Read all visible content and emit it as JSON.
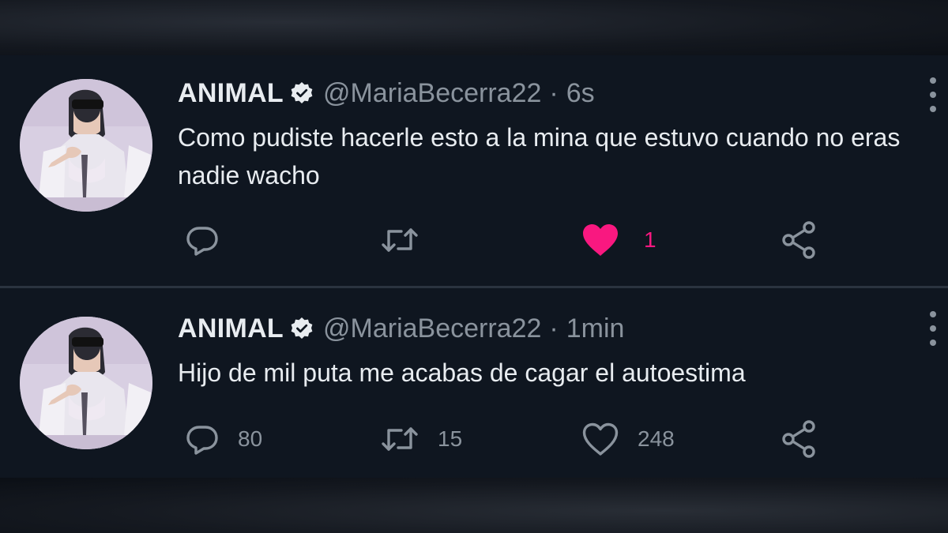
{
  "tweets": [
    {
      "name": "ANIMAL",
      "handle": "@MariaBecerra22",
      "separator": "·",
      "time": "6s",
      "text": "Como pudiste hacerle esto a la mina que estuvo cuando no eras nadie wacho",
      "replies": "",
      "retweets": "",
      "likes": "1",
      "liked": true,
      "icons": [
        "reply-icon",
        "retweet-icon",
        "heart-filled-icon",
        "share-icon"
      ]
    },
    {
      "name": "ANIMAL",
      "handle": "@MariaBecerra22",
      "separator": "·",
      "time": "1min",
      "text": "Hijo de mil puta me acabas de cagar el autoestima",
      "replies": "80",
      "retweets": "15",
      "likes": "248",
      "liked": false,
      "icons": [
        "reply-icon",
        "retweet-icon",
        "heart-icon",
        "share-icon"
      ]
    }
  ],
  "colors": {
    "background": "#0f1620",
    "text": "#e8ecf0",
    "muted": "#8a939d",
    "like": "#f91880",
    "verified_badge": "#e8ecf0"
  }
}
